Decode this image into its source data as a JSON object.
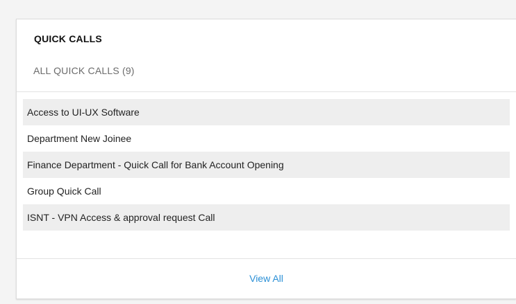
{
  "card": {
    "title": "QUICK CALLS",
    "tab_label": "ALL QUICK CALLS (9)",
    "items": [
      "Access to UI-UX Software",
      "Department New Joinee",
      "Finance Department - Quick Call for Bank Account Opening",
      "Group Quick Call",
      "ISNT - VPN Access & approval request Call"
    ],
    "view_all_label": "View All"
  },
  "colors": {
    "link": "#2a8fd6",
    "row_stripe": "#eeeeee",
    "page_background": "#f4f4f4"
  }
}
